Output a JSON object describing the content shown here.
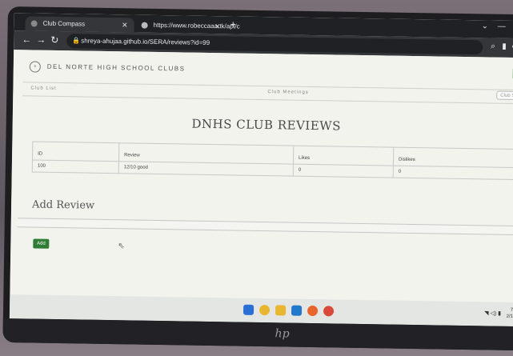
{
  "browser": {
    "tabs": [
      {
        "title": "Club Compass",
        "active": true
      },
      {
        "title": "https://www.robeccaaa.tk/api/c",
        "active": false
      }
    ],
    "new_tab": "+",
    "address": "shreya-ahujaa.github.io/SERA/reviews?id=99",
    "window_controls": [
      "⌄",
      "—",
      "◻"
    ]
  },
  "site": {
    "title": "DEL NORTE HIGH SCHOOL CLUBS",
    "login_label": "L",
    "nav": {
      "club_list": "Club List",
      "club_meetings": "Club Meetings",
      "search_placeholder": "Club S"
    }
  },
  "page": {
    "heading": "DNHS CLUB REVIEWS",
    "table": {
      "headers": [
        "ID",
        "Review",
        "Likes",
        "Dislikes"
      ],
      "rows": [
        {
          "id": "100",
          "review": "12/10 good",
          "likes": "0",
          "dislikes": "0"
        }
      ]
    },
    "add_heading": "Add Review",
    "add_button": "Add"
  },
  "taskbar": {
    "clock_time": "7:0",
    "clock_date": "2/16/"
  },
  "icons": {
    "windows": "windows-icon",
    "chrome": "chrome-icon",
    "explorer": "folder-icon",
    "vscode": "vscode-icon",
    "postman": "postman-icon"
  },
  "colors": {
    "accent_green": "#2f7d34",
    "page_bg": "#f1f3ec"
  }
}
